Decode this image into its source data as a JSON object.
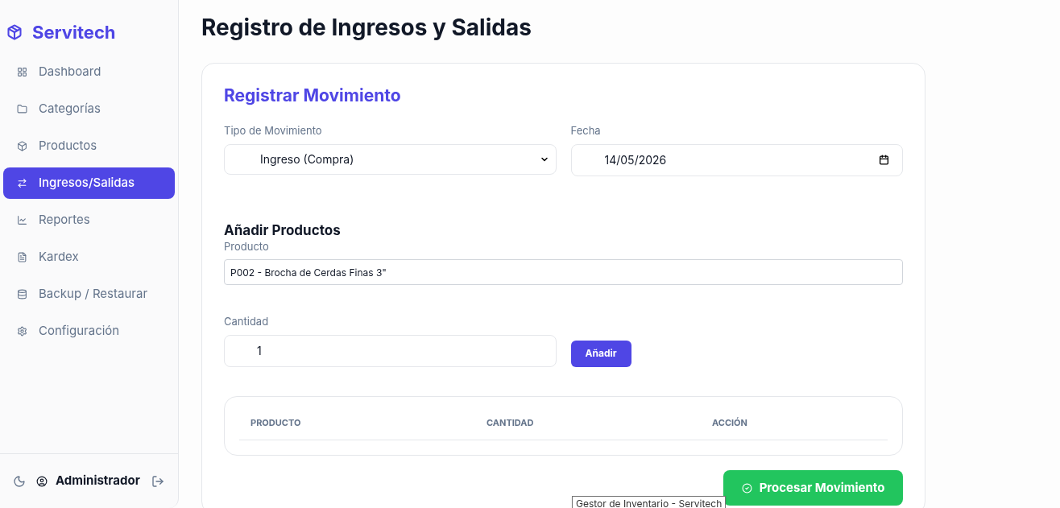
{
  "sidebar": {
    "brand": "Servitech",
    "items": [
      {
        "label": "Dashboard",
        "selected": false
      },
      {
        "label": "Categorías",
        "selected": false
      },
      {
        "label": "Productos",
        "selected": false
      },
      {
        "label": "Ingresos/Salidas",
        "selected": true
      },
      {
        "label": "Reportes",
        "selected": false
      },
      {
        "label": "Kardex",
        "selected": false
      },
      {
        "label": "Backup / Restaurar",
        "selected": false
      },
      {
        "label": "Configuración",
        "selected": false
      }
    ],
    "user": "Administrador"
  },
  "page_title": "Registro de Ingresos y Salidas",
  "form": {
    "title": "Registrar Movimiento",
    "type_label": "Tipo de Movimiento",
    "type_value": "Ingreso (Compra)",
    "date_label": "Fecha",
    "date_value": "14/05/2026",
    "section_title": "Añadir Productos",
    "product_label": "Producto",
    "product_value": "P002 - Brocha de Cerdas Finas 3\"",
    "quantity_label": "Cantidad",
    "quantity_value": "1",
    "add_button": "Añadir",
    "table": {
      "columns": [
        "PRODUCTO",
        "CANTIDAD",
        "ACCIÓN"
      ]
    },
    "submit_button": "Procesar Movimiento"
  },
  "tooltip": "Gestor de Inventario - Servitech"
}
